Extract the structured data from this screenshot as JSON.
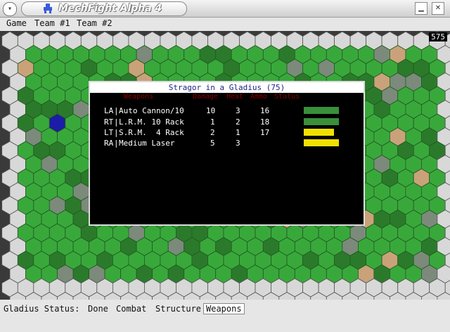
{
  "window": {
    "title": "MechFight Alpha 4",
    "menu_glyph": "▾",
    "minimize_glyph": "▁",
    "close_glyph": "✕"
  },
  "menubar": {
    "items": [
      "Game",
      "Team #1",
      "Team #2"
    ]
  },
  "board": {
    "turn_counter": "575"
  },
  "popup": {
    "title": "Stragor in a Gladius (75)",
    "headers": {
      "weapons": "Weapons",
      "damage": "Damage",
      "heat": "Heat",
      "ammo": "Ammo",
      "status": "Status"
    },
    "rows": [
      {
        "loc": "LA",
        "name": "Auto Cannon/10",
        "damage": "10",
        "heat": "3",
        "ammo": "16",
        "status_color": "#3a8f3a",
        "status_level": 1.0
      },
      {
        "loc": "RT",
        "name": "L.R.M. 10 Rack",
        "damage": "1",
        "heat": "2",
        "ammo": "18",
        "status_color": "#3a8f3a",
        "status_level": 1.0
      },
      {
        "loc": "LT",
        "name": "S.R.M.  4 Rack",
        "damage": "2",
        "heat": "1",
        "ammo": "17",
        "status_color": "#f0e000",
        "status_level": 0.85
      },
      {
        "loc": "RA",
        "name": "Medium Laser",
        "damage": "5",
        "heat": "3",
        "ammo": "",
        "status_color": "#f0e000",
        "status_level": 1.0
      }
    ]
  },
  "statusbar": {
    "label": "Gladius Status:",
    "tabs": [
      {
        "label": "Done",
        "active": false
      },
      {
        "label": "Combat",
        "active": false
      },
      {
        "label": "Structure",
        "active": false
      },
      {
        "label": "Weapons",
        "active": true
      }
    ]
  },
  "colors": {
    "grass": "#39a83b",
    "forest": "#2b7a2b",
    "rough": "#7b8a7b",
    "sand": "#c9a27a",
    "water": "#1c1ca8",
    "border": "#d8d8d8"
  }
}
